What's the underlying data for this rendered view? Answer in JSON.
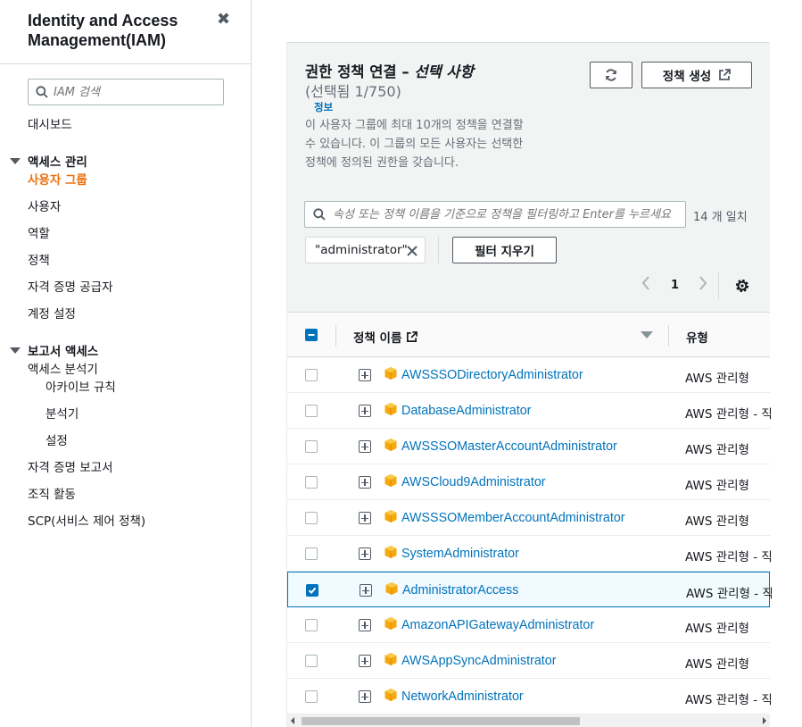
{
  "sidebar": {
    "title": "Identity and Access Management(IAM)",
    "close_glyph": "✖",
    "search_placeholder": "IAM 검색",
    "dashboard": "대시보드",
    "access_group": "액세스 관리",
    "access_items": [
      "사용자 그룹",
      "사용자",
      "역할",
      "정책",
      "자격 증명 공급자",
      "계정 설정"
    ],
    "report_group": "보고서 액세스",
    "report_items": [
      "액세스 분석기",
      "아카이브 규칙",
      "분석기",
      "설정",
      "자격 증명 보고서",
      "조직 활동",
      "SCP(서비스 제어 정책)"
    ]
  },
  "panel": {
    "title": "권한 정책 연결 –",
    "title_optional": "선택 사항",
    "count": "(선택됨 1/750)",
    "info": "정보",
    "description": "이 사용자 그룹에 최대 10개의 정책을 연결할 수 있습니다. 이 그룹의 모든 사용자는 선택한 정책에 정의된 권한을 갖습니다.",
    "create_button": "정책 생성",
    "filter_placeholder": "속성 또는 정책 이름을 기준으로 정책을 필터링하고 Enter를 누르세요",
    "match_count": "14 개 일치",
    "filter_token": "\"administrator\"",
    "clear_button": "필터 지우기",
    "page": "1"
  },
  "table": {
    "col_name": "정책 이름",
    "col_type": "유형",
    "rows": [
      {
        "name": "AWSSSODirectoryAdministrator",
        "type": "AWS 관리형"
      },
      {
        "name": "DatabaseAdministrator",
        "type": "AWS 관리형 - 직"
      },
      {
        "name": "AWSSSOMasterAccountAdministrator",
        "type": "AWS 관리형"
      },
      {
        "name": "AWSCloud9Administrator",
        "type": "AWS 관리형"
      },
      {
        "name": "AWSSSOMemberAccountAdministrator",
        "type": "AWS 관리형"
      },
      {
        "name": "SystemAdministrator",
        "type": "AWS 관리형 - 직"
      },
      {
        "name": "AdministratorAccess",
        "type": "AWS 관리형 - 직"
      },
      {
        "name": "AmazonAPIGatewayAdministrator",
        "type": "AWS 관리형"
      },
      {
        "name": "AWSAppSyncAdministrator",
        "type": "AWS 관리형"
      },
      {
        "name": "NetworkAdministrator",
        "type": "AWS 관리형 - 직"
      }
    ],
    "selected_row": 6
  },
  "colors": {
    "accent_orange": "#ec7211",
    "link_blue": "#0073bb",
    "policy_icon": "#f7a80d"
  }
}
